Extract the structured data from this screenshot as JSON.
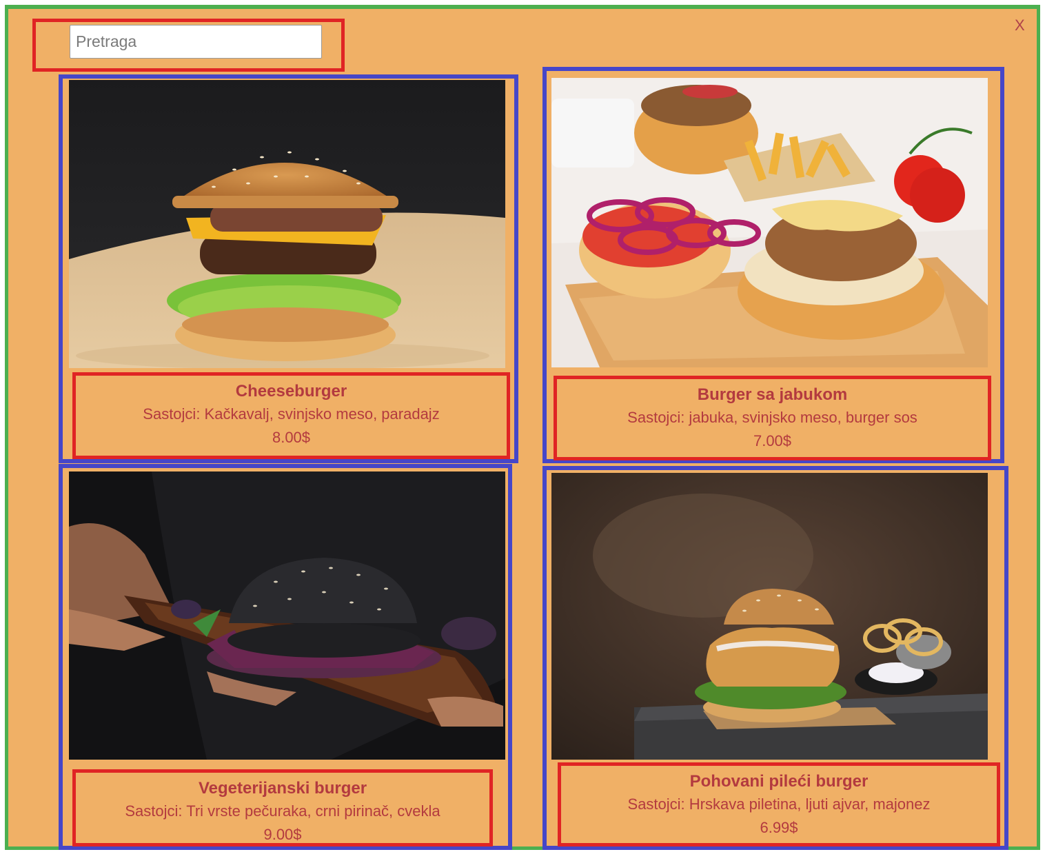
{
  "header": {
    "close_label": "X",
    "search_placeholder": "Pretraga"
  },
  "menu_items": [
    {
      "name": "Cheeseburger",
      "ingredients": "Sastojci: Kačkavalj, svinjsko meso, paradajz",
      "price": "8.00$"
    },
    {
      "name": "Burger sa jabukom",
      "ingredients": "Sastojci: jabuka, svinjsko meso, burger sos",
      "price": "7.00$"
    },
    {
      "name": "Vegeterijanski burger",
      "ingredients": "Sastojci: Tri vrste pečuraka, crni pirinač, cvekla",
      "price": "9.00$"
    },
    {
      "name": "Pohovani pileći burger",
      "ingredients": "Sastojci: Hrskava piletina, ljuti ajvar, majonez",
      "price": "6.99$"
    }
  ],
  "colors": {
    "background": "#f0b066",
    "outer_border": "#4caf50",
    "card_border": "#4646c8",
    "info_border": "#e02424",
    "text": "#b33a3f"
  }
}
